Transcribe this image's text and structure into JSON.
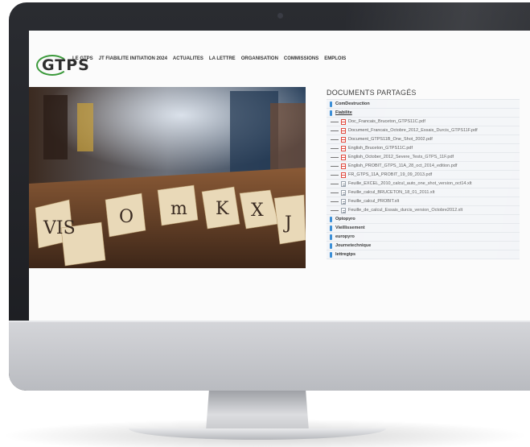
{
  "header": {
    "logo_text": "GTPS",
    "nav": [
      "LE GTPS",
      "JT FIABILITE INITIATION 2024",
      "ACTUALITES",
      "LA LETTRE",
      "ORGANISATION",
      "COMMISSIONS",
      "EMPLOIS"
    ]
  },
  "docs": {
    "title": "DOCUMENTS PARTAGÉS",
    "folder_top": "ComDestruction",
    "folder_open": "Fiabilite",
    "pdf_files": [
      "Doc_Francais_Bruceton_GTPS11C.pdf",
      "Document_Francais_Octobre_2012_Essais_Durcis_GTPS11F.pdf",
      "Document_GTPS11B_One_Shot_2002.pdf",
      "English_Bruceton_GTPS11C.pdf",
      "English_October_2012_Severe_Tests_GTPS_11F.pdf",
      "English_PROBIT_GTPS_11A_28_oct_2014_edition.pdf",
      "FR_GTPS_11A_PROBIT_19_09_2013.pdf"
    ],
    "xls_files": [
      "Feuille_EXCEL_2010_calcul_auto_one_shot_version_oct14.xlt",
      "Feuille_calcul_BRUCETON_18_01_2011.xlt",
      "Feuille_calcul_PROBIT.xlt",
      "Feuille_de_calcul_Essais_durcis_version_Octobre2012.xlt"
    ],
    "folders_bottom": [
      "Optopyro",
      "Vieillissement",
      "europyro",
      "Journetechnique",
      "lettregtps"
    ]
  },
  "colors": {
    "accent_green": "#3c9a3c",
    "folder_blue": "#3b8ed6",
    "pdf_red": "#e04a3f"
  }
}
